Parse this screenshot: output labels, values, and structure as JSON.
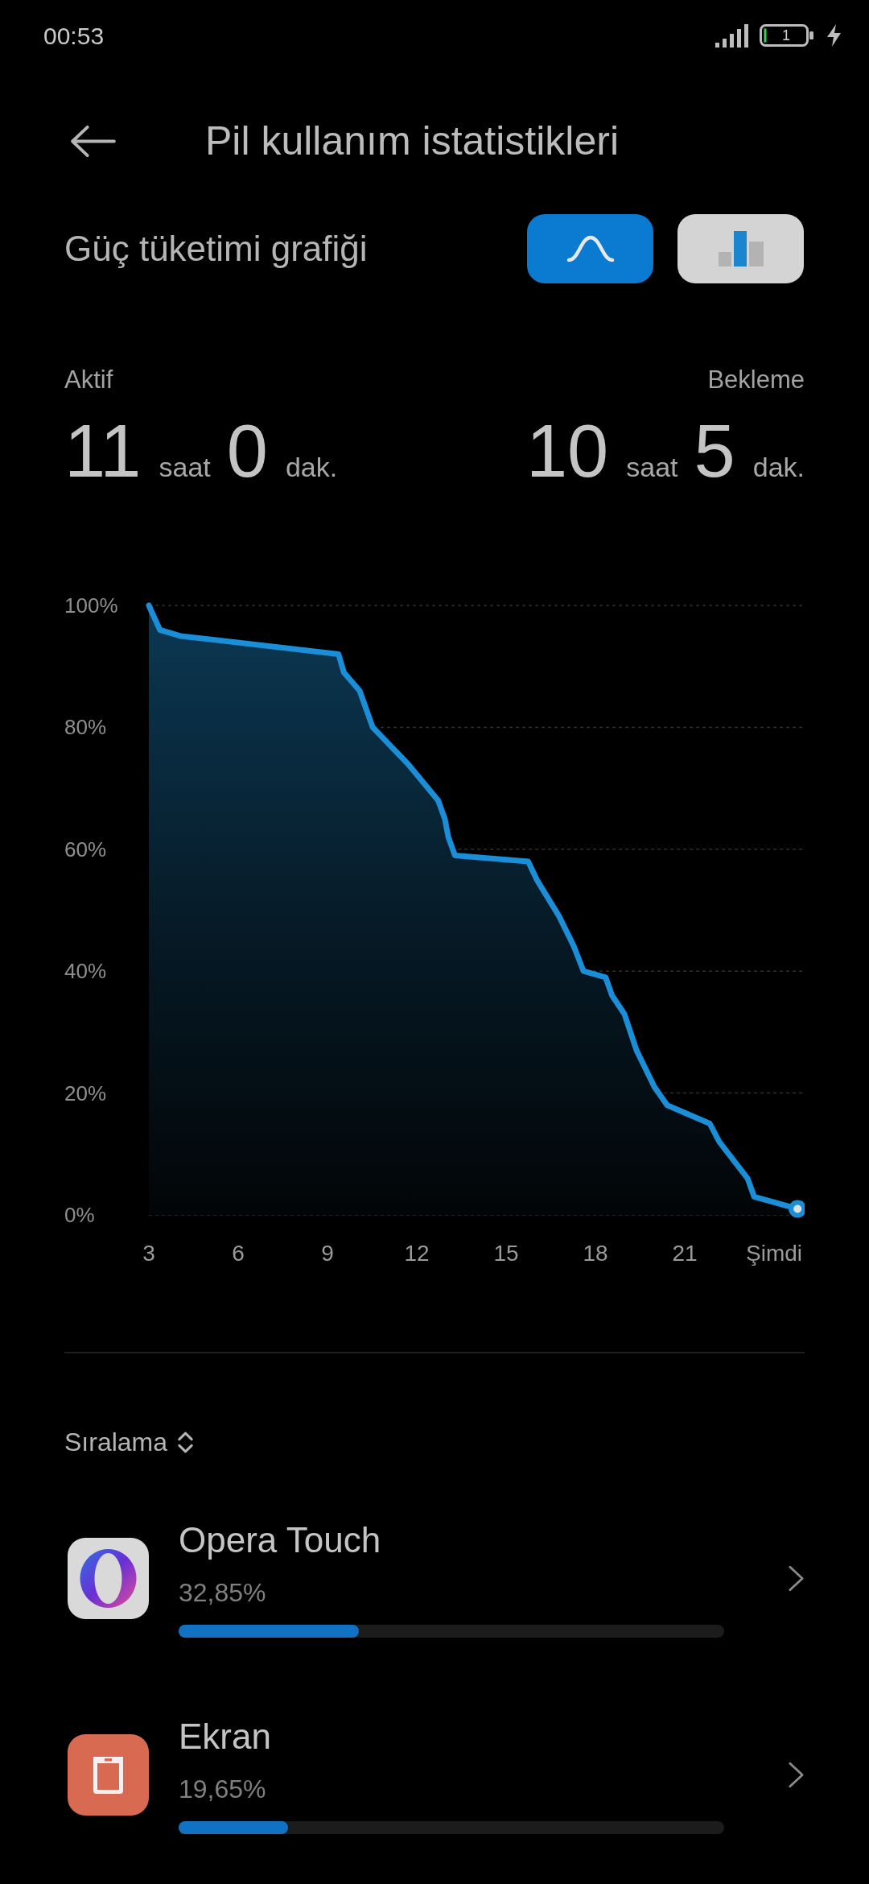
{
  "status_bar": {
    "time": "00:53",
    "battery": "1",
    "charging": true
  },
  "header": {
    "title": "Pil kullanım istatistikleri"
  },
  "graph_section": {
    "title": "Güç tüketimi grafiği",
    "view_toggle": [
      {
        "kind": "line",
        "selected": true
      },
      {
        "kind": "bar",
        "selected": false
      }
    ],
    "stats": [
      {
        "label": "Aktif",
        "hours": "11",
        "hours_unit": "saat",
        "minutes": "0",
        "minutes_unit": "dak."
      },
      {
        "label": "Bekleme",
        "hours": "10",
        "hours_unit": "saat",
        "minutes": "5",
        "minutes_unit": "dak."
      }
    ],
    "chart_data": {
      "type": "area",
      "grid": true,
      "x": [
        3,
        3.37,
        4.06,
        9.37,
        9.55,
        10.08,
        10.52,
        11.7,
        12.72,
        12.94,
        13.06,
        13.28,
        15.74,
        16.03,
        16.78,
        17.28,
        17.6,
        18.34,
        18.56,
        18.97,
        19.38,
        19.98,
        20.41,
        21.84,
        22.16,
        23.11,
        23.33,
        24.79
      ],
      "values": [
        100,
        96,
        95,
        92,
        89,
        86,
        80,
        74,
        68,
        65,
        62,
        59,
        58,
        55,
        49,
        44,
        40,
        39,
        36,
        33,
        27,
        21,
        18,
        15,
        12,
        6,
        3,
        1
      ],
      "xlim": [
        3,
        25
      ],
      "ylim": [
        0,
        100
      ],
      "xticks": [
        3,
        6,
        9,
        12,
        15,
        18,
        21,
        {
          "value": 24,
          "label": "Şimdi"
        }
      ],
      "yticks": [
        {
          "value": 0,
          "label": "0%"
        },
        {
          "value": 20,
          "label": "20%"
        },
        {
          "value": 40,
          "label": "40%"
        },
        {
          "value": 60,
          "label": "60%"
        },
        {
          "value": 80,
          "label": "80%"
        },
        {
          "value": 100,
          "label": "100%"
        }
      ]
    }
  },
  "sort": {
    "label": "Sıralama"
  },
  "apps": [
    {
      "name": "Opera Touch",
      "percent": "32,85%",
      "level": 0.33
    },
    {
      "name": "Ekran",
      "percent": "19,65%",
      "level": 0.2
    }
  ]
}
